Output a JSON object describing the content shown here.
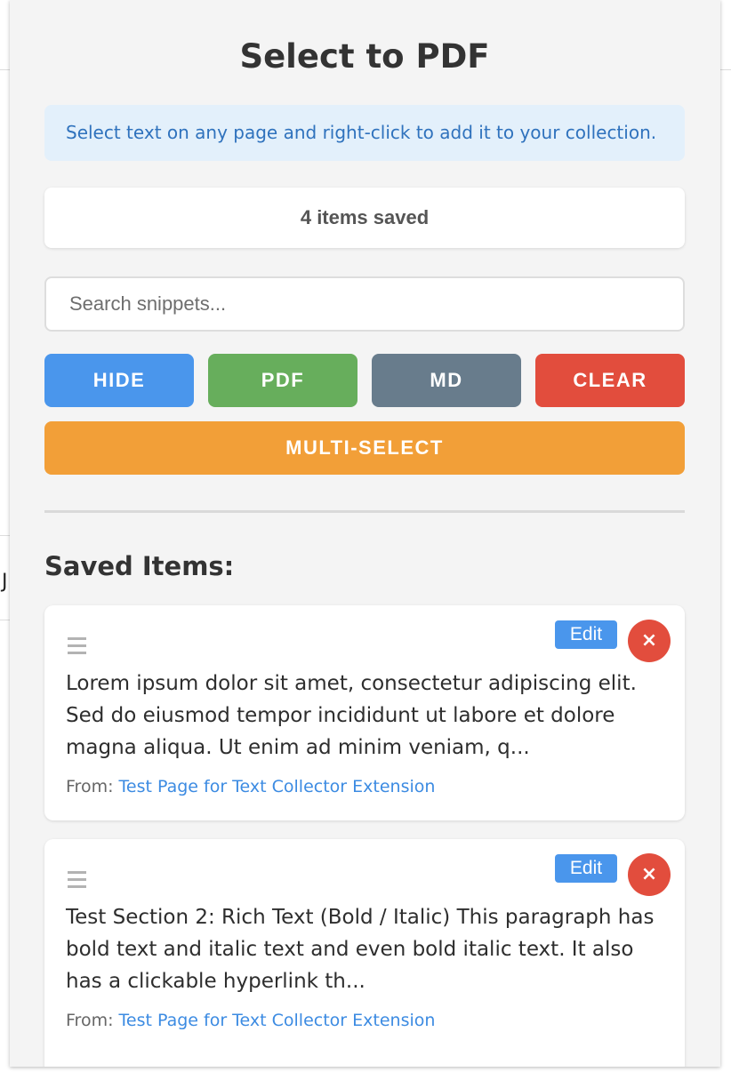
{
  "header": {
    "title": "Select to PDF"
  },
  "info": {
    "message": "Select text on any page and right-click to add it to your collection."
  },
  "status": {
    "count_text": "4 items saved"
  },
  "search": {
    "placeholder": "Search snippets...",
    "value": ""
  },
  "actions": {
    "hide_label": "HIDE",
    "pdf_label": "PDF",
    "md_label": "MD",
    "clear_label": "CLEAR",
    "multi_select_label": "MULTI-SELECT"
  },
  "saved": {
    "heading": "Saved Items:",
    "items": [
      {
        "text": "Lorem ipsum dolor sit amet, consectetur adipiscing elit. Sed do eiusmod tempor incididunt ut labore et dolore magna aliqua. Ut enim ad minim veniam, q...",
        "source_prefix": "From: ",
        "source_title": "Test Page for Text Collector Extension",
        "edit_label": "Edit",
        "delete_label": "×"
      },
      {
        "text": "Test Section 2: Rich Text (Bold / Italic) This paragraph has bold text and italic text and even bold italic text. It also has a clickable hyperlink th...",
        "source_prefix": "From: ",
        "source_title": "Test Page for Text Collector Extension",
        "edit_label": "Edit",
        "delete_label": "×"
      }
    ]
  },
  "background": {
    "glyph": "J"
  },
  "colors": {
    "accent_blue": "#4a96ec",
    "pdf_green": "#67ae5c",
    "md_gray": "#687c8c",
    "clear_red": "#e24d3d",
    "multi_orange": "#f29f38",
    "info_bg": "#e3f0fb",
    "link_blue": "#3c8be2"
  },
  "icons": {
    "drag": "drag-handle-icon",
    "delete": "close-icon"
  }
}
